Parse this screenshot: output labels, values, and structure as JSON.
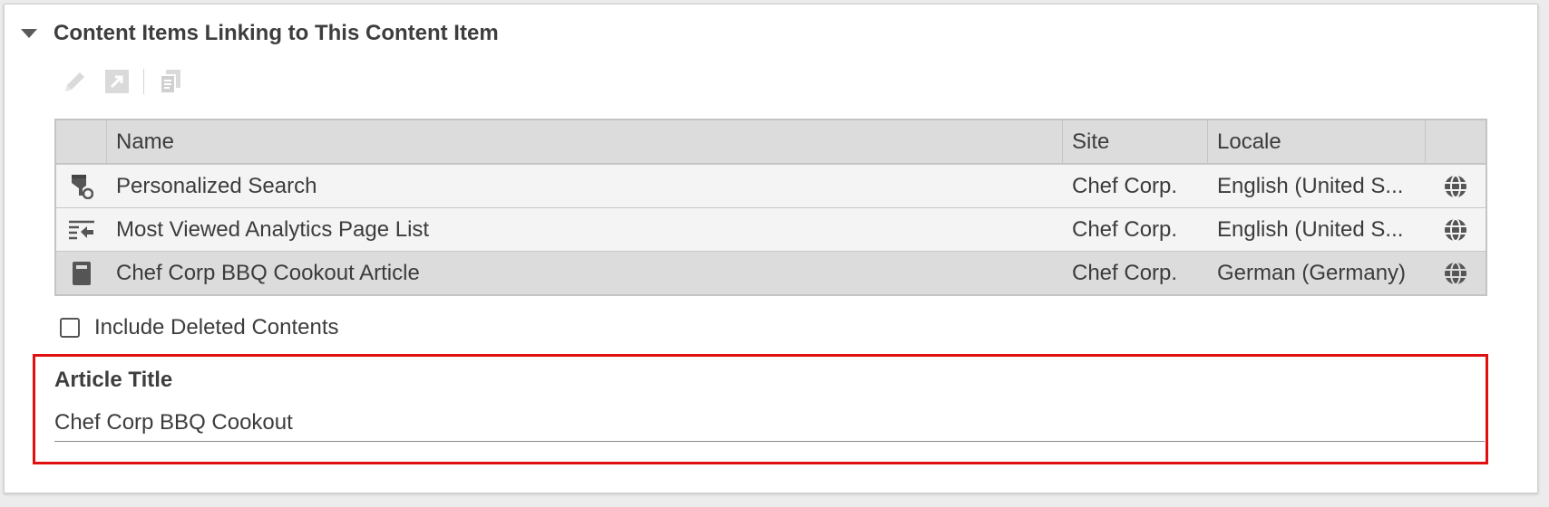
{
  "panel": {
    "title": "Content Items Linking to This Content Item"
  },
  "toolbar": {
    "buttons": [
      {
        "icon": "pencil-icon",
        "enabled": false
      },
      {
        "icon": "open-in-tab-icon",
        "enabled": false
      },
      {
        "icon": "copy-icon",
        "enabled": false
      }
    ]
  },
  "table": {
    "headers": {
      "name": "Name",
      "site": "Site",
      "locale": "Locale"
    },
    "rows": [
      {
        "icon": "personalized-search-icon",
        "name": "Personalized Search",
        "site": "Chef Corp.",
        "locale": "English (United S...",
        "action_icon": "globe-icon"
      },
      {
        "icon": "page-list-icon",
        "name": "Most Viewed Analytics Page List",
        "site": "Chef Corp.",
        "locale": "English (United S...",
        "action_icon": "globe-icon"
      },
      {
        "icon": "article-icon",
        "name": "Chef Corp BBQ Cookout Article",
        "site": "Chef Corp.",
        "locale": "German (Germany)",
        "action_icon": "globe-icon",
        "selected": true
      }
    ]
  },
  "include_deleted": {
    "label": "Include Deleted Contents",
    "checked": false
  },
  "article_title": {
    "label": "Article Title",
    "value": "Chef Corp BBQ Cookout"
  },
  "colors": {
    "highlight": "#e01010",
    "header_bg": "#dcdcdc",
    "row_bg": "#f4f4f4",
    "text": "#3c3c3c"
  }
}
